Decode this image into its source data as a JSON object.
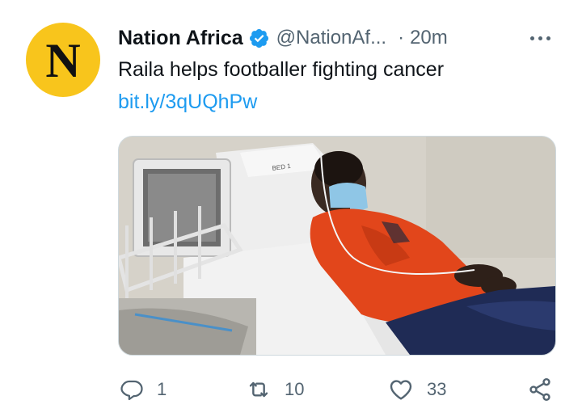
{
  "tweet": {
    "avatar_letter": "N",
    "display_name": "Nation Africa",
    "handle": "@NationAf...",
    "separator": "·",
    "timestamp": "20m",
    "text": "Raila helps footballer fighting cancer",
    "link": "bit.ly/3qUQhPw",
    "media_hospital_text": "BED 1",
    "actions": {
      "reply_count": "1",
      "retweet_count": "10",
      "like_count": "33"
    }
  },
  "icons": {
    "verified": "verified-badge-icon",
    "more": "more-dots-icon",
    "reply": "reply-icon",
    "retweet": "retweet-icon",
    "like": "heart-icon",
    "share": "share-icon"
  },
  "colors": {
    "accent": "#1d9bf0",
    "avatar_bg": "#f8c51c",
    "secondary_text": "#536471",
    "primary_text": "#0f1419"
  }
}
